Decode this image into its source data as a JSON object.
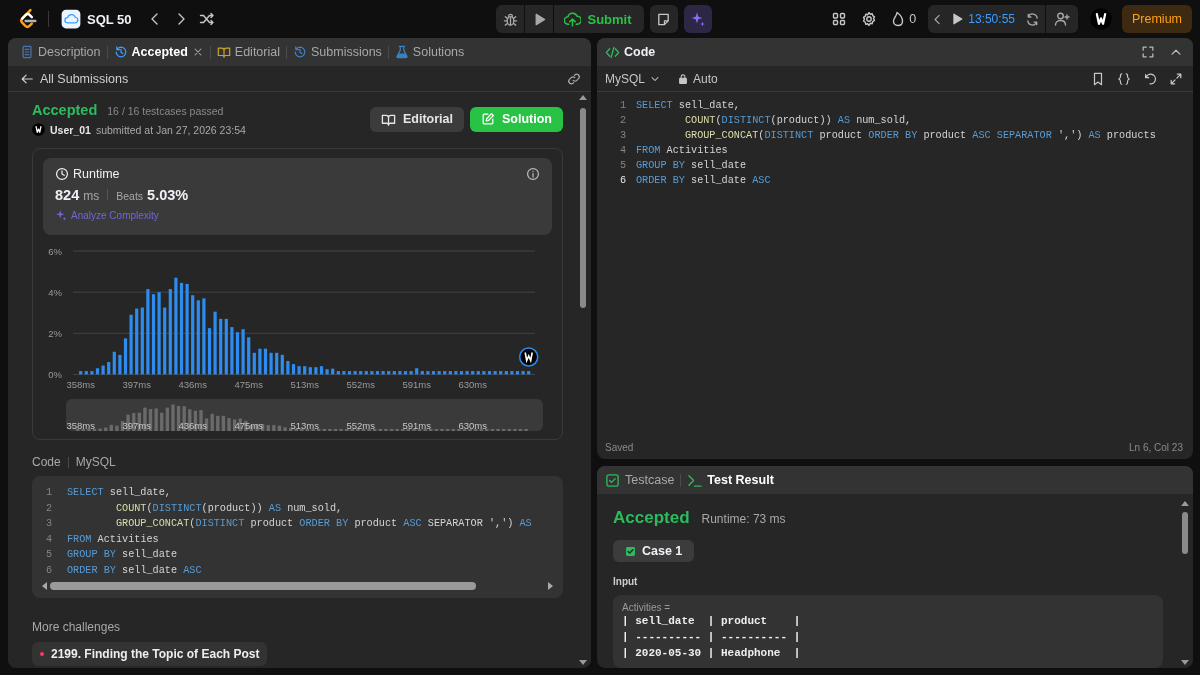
{
  "topbar": {
    "list_title": "SQL 50",
    "submit_label": "Submit",
    "streak_count": "0",
    "timer": "13:50:55",
    "premium_label": "Premium"
  },
  "description_panel": {
    "tabs": [
      {
        "label": "Description",
        "selected": false,
        "closable": false
      },
      {
        "label": "Accepted",
        "selected": true,
        "closable": true
      },
      {
        "label": "Editorial",
        "selected": false,
        "closable": false
      },
      {
        "label": "Submissions",
        "selected": false,
        "closable": false
      },
      {
        "label": "Solutions",
        "selected": false,
        "closable": false
      }
    ],
    "back_link": "All Submissions",
    "submission": {
      "status": "Accepted",
      "testcases": "16 / 16 testcases passed",
      "user": "User_01",
      "submitted": "submitted at Jan 27, 2026 23:54",
      "buttons": [
        {
          "label": "Editorial",
          "kind": "secondary"
        },
        {
          "label": "Solution",
          "kind": "primary"
        }
      ]
    },
    "runtime": {
      "title": "Runtime",
      "value": "824",
      "unit": "ms",
      "beats_label": "Beats",
      "beats_value": "5.03%",
      "analyze": "Analyze Complexity",
      "chart_data": {
        "type": "bar",
        "ylim": [
          0,
          6
        ],
        "yticks": [
          {
            "value": 0,
            "label": "0%"
          },
          {
            "value": 2,
            "label": "2%"
          },
          {
            "value": 4,
            "label": "4%"
          },
          {
            "value": 6,
            "label": "6%"
          }
        ],
        "categories": [
          "358ms",
          null,
          null,
          null,
          null,
          null,
          null,
          null,
          null,
          null,
          "397ms",
          null,
          null,
          null,
          null,
          null,
          null,
          null,
          null,
          null,
          "436ms",
          null,
          null,
          null,
          null,
          null,
          null,
          null,
          null,
          null,
          "475ms",
          null,
          null,
          null,
          null,
          null,
          null,
          null,
          null,
          null,
          "513ms",
          null,
          null,
          null,
          null,
          null,
          null,
          null,
          null,
          null,
          "552ms",
          null,
          null,
          null,
          null,
          null,
          null,
          null,
          null,
          null,
          "591ms",
          null,
          null,
          null,
          null,
          null,
          null,
          null,
          null,
          null,
          "630ms",
          null,
          null,
          null,
          null,
          null,
          null,
          null,
          null,
          null,
          null
        ],
        "values": [
          0.16,
          0.16,
          0.16,
          0.3,
          0.43,
          0.6,
          1.1,
          0.95,
          1.75,
          2.9,
          3.2,
          3.25,
          4.15,
          3.9,
          4.0,
          3.25,
          4.15,
          4.7,
          4.45,
          4.4,
          3.85,
          3.6,
          3.7,
          2.25,
          3.05,
          2.7,
          2.7,
          2.3,
          2.05,
          2.2,
          1.8,
          1.05,
          1.25,
          1.25,
          1.05,
          1.05,
          0.95,
          0.65,
          0.5,
          0.4,
          0.4,
          0.35,
          0.35,
          0.4,
          0.25,
          0.28,
          0.16,
          0.16,
          0.16,
          0.16,
          0.16,
          0.16,
          0.16,
          0.16,
          0.16,
          0.16,
          0.16,
          0.16,
          0.16,
          0.16,
          0.3,
          0.16,
          0.16,
          0.16,
          0.16,
          0.16,
          0.16,
          0.16,
          0.16,
          0.16,
          0.16,
          0.16,
          0.16,
          0.16,
          0.16,
          0.16,
          0.16,
          0.16,
          0.16,
          0.16,
          0.16
        ]
      }
    },
    "overview_ticks": [
      "358ms",
      "397ms",
      "436ms",
      "475ms",
      "513ms",
      "552ms",
      "591ms",
      "630ms"
    ],
    "code_label": "Code",
    "code_language": "MySQL",
    "code": [
      {
        "number": "1",
        "tokens": [
          {
            "text": "SELECT",
            "kind": "keyword"
          },
          {
            "text": " sell_date,",
            "kind": "plain"
          }
        ]
      },
      {
        "number": "2",
        "tokens": [
          {
            "text": "        COUNT",
            "kind": "function"
          },
          {
            "text": "(",
            "kind": "plain"
          },
          {
            "text": "DISTINCT",
            "kind": "keyword"
          },
          {
            "text": "(product)) ",
            "kind": "plain"
          },
          {
            "text": "AS",
            "kind": "keyword"
          },
          {
            "text": " num_sold,",
            "kind": "plain"
          }
        ]
      },
      {
        "number": "3",
        "tokens": [
          {
            "text": "        GROUP_CONCAT",
            "kind": "function"
          },
          {
            "text": "(",
            "kind": "plain"
          },
          {
            "text": "DISTINCT",
            "kind": "keyword"
          },
          {
            "text": " product ",
            "kind": "plain"
          },
          {
            "text": "ORDER BY",
            "kind": "keyword"
          },
          {
            "text": " product ",
            "kind": "plain"
          },
          {
            "text": "ASC",
            "kind": "keyword"
          },
          {
            "text": " SEPARATOR ','",
            "kind": "plain"
          },
          {
            "text": ") ",
            "kind": "plain"
          },
          {
            "text": "AS",
            "kind": "keyword"
          }
        ]
      },
      {
        "number": "4",
        "tokens": [
          {
            "text": "FROM",
            "kind": "keyword"
          },
          {
            "text": " Activities",
            "kind": "plain"
          }
        ]
      },
      {
        "number": "5",
        "tokens": [
          {
            "text": "GROUP BY",
            "kind": "keyword"
          },
          {
            "text": " sell_date",
            "kind": "plain"
          }
        ]
      },
      {
        "number": "6",
        "tokens": [
          {
            "text": "ORDER BY",
            "kind": "keyword"
          },
          {
            "text": " sell_date ",
            "kind": "plain"
          },
          {
            "text": "ASC",
            "kind": "keyword"
          }
        ]
      }
    ],
    "more_challenges": {
      "title": "More challenges",
      "items": [
        {
          "label": "2199. Finding the Topic of Each Post",
          "color": "#ff375f"
        }
      ]
    }
  },
  "code_panel": {
    "title": "Code",
    "language": "MySQL",
    "mode": "Auto",
    "lines": [
      {
        "number": "1",
        "active": false,
        "tokens": [
          {
            "text": "SELECT",
            "kind": "keyword"
          },
          {
            "text": " sell_date,",
            "kind": "plain"
          }
        ]
      },
      {
        "number": "2",
        "active": false,
        "tokens": [
          {
            "text": "        COUNT",
            "kind": "function"
          },
          {
            "text": "(",
            "kind": "plain"
          },
          {
            "text": "DISTINCT",
            "kind": "keyword"
          },
          {
            "text": "(product)) ",
            "kind": "plain"
          },
          {
            "text": "AS",
            "kind": "keyword"
          },
          {
            "text": " num_sold,",
            "kind": "plain"
          }
        ]
      },
      {
        "number": "3",
        "active": false,
        "tokens": [
          {
            "text": "        GROUP_CONCAT",
            "kind": "function"
          },
          {
            "text": "(",
            "kind": "plain"
          },
          {
            "text": "DISTINCT",
            "kind": "keyword"
          },
          {
            "text": " product ",
            "kind": "plain"
          },
          {
            "text": "ORDER BY",
            "kind": "keyword"
          },
          {
            "text": " product ",
            "kind": "plain"
          },
          {
            "text": "ASC SEPARATOR",
            "kind": "keyword"
          },
          {
            "text": " ',') ",
            "kind": "plain"
          },
          {
            "text": "AS",
            "kind": "keyword"
          },
          {
            "text": " products",
            "kind": "plain"
          }
        ]
      },
      {
        "number": "4",
        "active": false,
        "tokens": [
          {
            "text": "FROM",
            "kind": "keyword"
          },
          {
            "text": " Activities",
            "kind": "plain"
          }
        ]
      },
      {
        "number": "5",
        "active": false,
        "tokens": [
          {
            "text": "GROUP BY",
            "kind": "keyword"
          },
          {
            "text": " sell_date",
            "kind": "plain"
          }
        ]
      },
      {
        "number": "6",
        "active": true,
        "tokens": [
          {
            "text": "ORDER BY",
            "kind": "keyword"
          },
          {
            "text": " sell_date ",
            "kind": "plain"
          },
          {
            "text": "ASC",
            "kind": "keyword"
          }
        ]
      }
    ],
    "status": "Saved",
    "cursor": "Ln 6, Col 23"
  },
  "result_panel": {
    "tabs": [
      {
        "label": "Testcase",
        "selected": false
      },
      {
        "label": "Test Result",
        "selected": true
      }
    ],
    "status": "Accepted",
    "runtime": "Runtime: 73 ms",
    "cases": [
      {
        "label": "Case 1",
        "selected": true,
        "passed": true
      }
    ],
    "input_label": "Input",
    "input_name": "Activities =",
    "table_lines": [
      "| sell_date  | product    |",
      "| ---------- | ---------- |",
      "| 2020-05-30 | Headphone  |"
    ]
  }
}
